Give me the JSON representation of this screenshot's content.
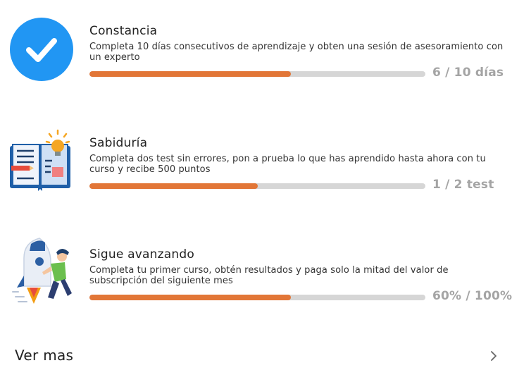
{
  "achievements": [
    {
      "title": "Constancia",
      "description": "Completa 10 días consecutivos de aprendizaje y obten una sesión de asesoramiento con un experto",
      "progress_text": "6 / 10 días",
      "progress": 0.6,
      "icon": "check-circle-icon"
    },
    {
      "title": "Sabiduría",
      "description": "Completa dos test sin errores, pon a prueba lo que has aprendido hasta ahora con tu curso y recibe 500 puntos",
      "progress_text": "1 / 2 test",
      "progress": 0.5,
      "icon": "book-lightbulb-icon"
    },
    {
      "title": "Sigue avanzando",
      "description": "Completa tu primer curso, obtén resultados y paga solo la mitad del valor de subscripción del siguiente mes",
      "progress_text": "60% / 100%",
      "progress": 0.6,
      "icon": "rocket-person-icon"
    }
  ],
  "footer": {
    "see_more_label": "Ver mas",
    "icon": "chevron-right-icon"
  },
  "colors": {
    "accent_orange": "#e27637",
    "track_gray": "#d6d6d6",
    "check_blue": "#2196f3",
    "count_gray": "#a4a4a4"
  }
}
